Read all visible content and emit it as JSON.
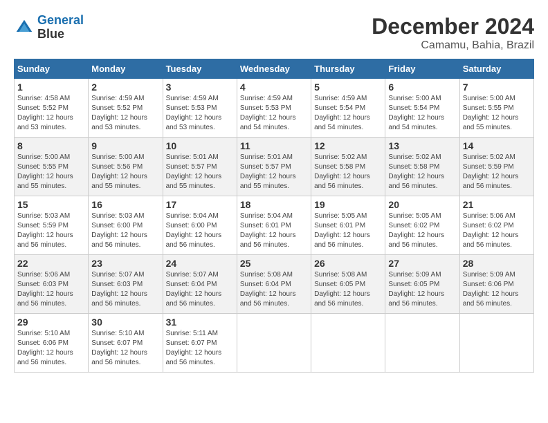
{
  "logo": {
    "line1": "General",
    "line2": "Blue"
  },
  "title": "December 2024",
  "location": "Camamu, Bahia, Brazil",
  "weekdays": [
    "Sunday",
    "Monday",
    "Tuesday",
    "Wednesday",
    "Thursday",
    "Friday",
    "Saturday"
  ],
  "weeks": [
    [
      {
        "day": "1",
        "sunrise": "4:58 AM",
        "sunset": "5:52 PM",
        "daylight": "12 hours and 53 minutes."
      },
      {
        "day": "2",
        "sunrise": "4:59 AM",
        "sunset": "5:52 PM",
        "daylight": "12 hours and 53 minutes."
      },
      {
        "day": "3",
        "sunrise": "4:59 AM",
        "sunset": "5:53 PM",
        "daylight": "12 hours and 53 minutes."
      },
      {
        "day": "4",
        "sunrise": "4:59 AM",
        "sunset": "5:53 PM",
        "daylight": "12 hours and 54 minutes."
      },
      {
        "day": "5",
        "sunrise": "4:59 AM",
        "sunset": "5:54 PM",
        "daylight": "12 hours and 54 minutes."
      },
      {
        "day": "6",
        "sunrise": "5:00 AM",
        "sunset": "5:54 PM",
        "daylight": "12 hours and 54 minutes."
      },
      {
        "day": "7",
        "sunrise": "5:00 AM",
        "sunset": "5:55 PM",
        "daylight": "12 hours and 55 minutes."
      }
    ],
    [
      {
        "day": "8",
        "sunrise": "5:00 AM",
        "sunset": "5:55 PM",
        "daylight": "12 hours and 55 minutes."
      },
      {
        "day": "9",
        "sunrise": "5:00 AM",
        "sunset": "5:56 PM",
        "daylight": "12 hours and 55 minutes."
      },
      {
        "day": "10",
        "sunrise": "5:01 AM",
        "sunset": "5:57 PM",
        "daylight": "12 hours and 55 minutes."
      },
      {
        "day": "11",
        "sunrise": "5:01 AM",
        "sunset": "5:57 PM",
        "daylight": "12 hours and 55 minutes."
      },
      {
        "day": "12",
        "sunrise": "5:02 AM",
        "sunset": "5:58 PM",
        "daylight": "12 hours and 56 minutes."
      },
      {
        "day": "13",
        "sunrise": "5:02 AM",
        "sunset": "5:58 PM",
        "daylight": "12 hours and 56 minutes."
      },
      {
        "day": "14",
        "sunrise": "5:02 AM",
        "sunset": "5:59 PM",
        "daylight": "12 hours and 56 minutes."
      }
    ],
    [
      {
        "day": "15",
        "sunrise": "5:03 AM",
        "sunset": "5:59 PM",
        "daylight": "12 hours and 56 minutes."
      },
      {
        "day": "16",
        "sunrise": "5:03 AM",
        "sunset": "6:00 PM",
        "daylight": "12 hours and 56 minutes."
      },
      {
        "day": "17",
        "sunrise": "5:04 AM",
        "sunset": "6:00 PM",
        "daylight": "12 hours and 56 minutes."
      },
      {
        "day": "18",
        "sunrise": "5:04 AM",
        "sunset": "6:01 PM",
        "daylight": "12 hours and 56 minutes."
      },
      {
        "day": "19",
        "sunrise": "5:05 AM",
        "sunset": "6:01 PM",
        "daylight": "12 hours and 56 minutes."
      },
      {
        "day": "20",
        "sunrise": "5:05 AM",
        "sunset": "6:02 PM",
        "daylight": "12 hours and 56 minutes."
      },
      {
        "day": "21",
        "sunrise": "5:06 AM",
        "sunset": "6:02 PM",
        "daylight": "12 hours and 56 minutes."
      }
    ],
    [
      {
        "day": "22",
        "sunrise": "5:06 AM",
        "sunset": "6:03 PM",
        "daylight": "12 hours and 56 minutes."
      },
      {
        "day": "23",
        "sunrise": "5:07 AM",
        "sunset": "6:03 PM",
        "daylight": "12 hours and 56 minutes."
      },
      {
        "day": "24",
        "sunrise": "5:07 AM",
        "sunset": "6:04 PM",
        "daylight": "12 hours and 56 minutes."
      },
      {
        "day": "25",
        "sunrise": "5:08 AM",
        "sunset": "6:04 PM",
        "daylight": "12 hours and 56 minutes."
      },
      {
        "day": "26",
        "sunrise": "5:08 AM",
        "sunset": "6:05 PM",
        "daylight": "12 hours and 56 minutes."
      },
      {
        "day": "27",
        "sunrise": "5:09 AM",
        "sunset": "6:05 PM",
        "daylight": "12 hours and 56 minutes."
      },
      {
        "day": "28",
        "sunrise": "5:09 AM",
        "sunset": "6:06 PM",
        "daylight": "12 hours and 56 minutes."
      }
    ],
    [
      {
        "day": "29",
        "sunrise": "5:10 AM",
        "sunset": "6:06 PM",
        "daylight": "12 hours and 56 minutes."
      },
      {
        "day": "30",
        "sunrise": "5:10 AM",
        "sunset": "6:07 PM",
        "daylight": "12 hours and 56 minutes."
      },
      {
        "day": "31",
        "sunrise": "5:11 AM",
        "sunset": "6:07 PM",
        "daylight": "12 hours and 56 minutes."
      },
      null,
      null,
      null,
      null
    ]
  ]
}
